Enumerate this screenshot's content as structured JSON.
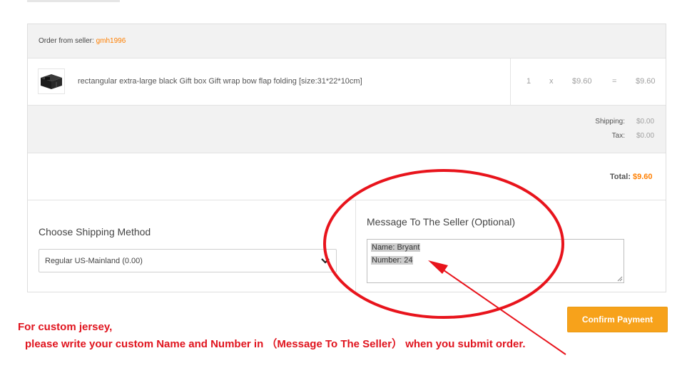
{
  "order": {
    "seller_label": "Order from seller:",
    "seller_name": "gmh1996",
    "item": {
      "title": "rectangular extra-large black Gift box Gift wrap bow flap folding [size:31*22*10cm]",
      "quantity": "1",
      "times": "x",
      "unit_price": "$9.60",
      "equals": "=",
      "line_total": "$9.60"
    },
    "shipping_label": "Shipping:",
    "shipping_value": "$0.00",
    "tax_label": "Tax:",
    "tax_value": "$0.00",
    "total_label": "Total:",
    "total_value": "$9.60"
  },
  "shipping_method": {
    "title": "Choose Shipping Method",
    "selected": "Regular US-Mainland (0.00)"
  },
  "message": {
    "title": "Message To The Seller (Optional)",
    "line1": "Name: Bryant",
    "line2": "Number: 24"
  },
  "confirm_label": "Confirm Payment",
  "annotation": {
    "line1": "For custom jersey,",
    "line2": "please write your custom Name and Number in （Message To The Seller） when you submit order."
  },
  "colors": {
    "accent": "#ff7f00",
    "confirm_button": "#f7a21b",
    "annotation_red": "#e0141e"
  },
  "icons": [
    "gift-box-thumbnail",
    "chevron-down-icon",
    "resize-handle-icon",
    "red-circle-annotation",
    "red-arrow-annotation"
  ]
}
